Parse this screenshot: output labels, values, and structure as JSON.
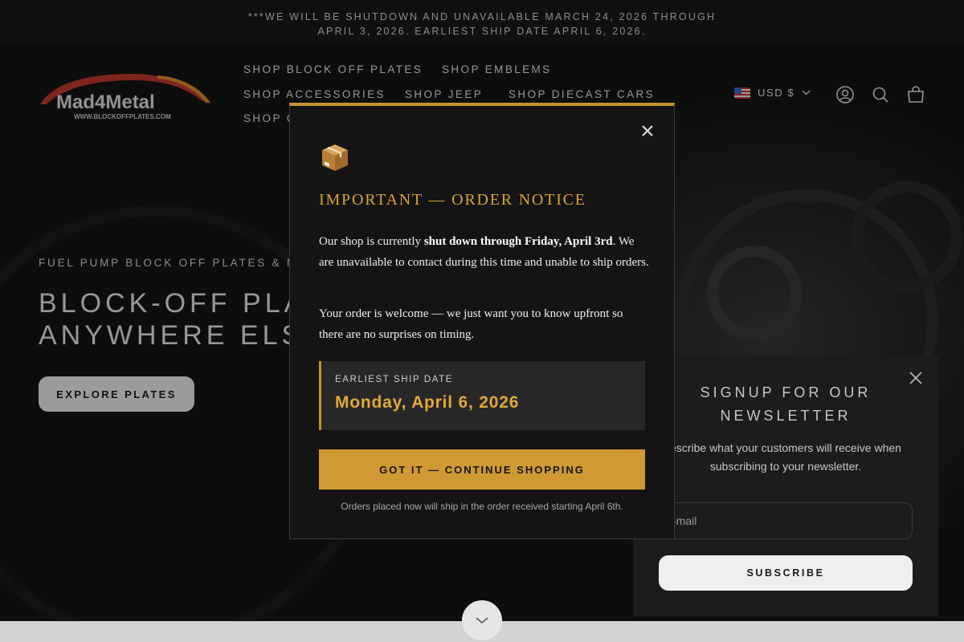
{
  "announcement": {
    "line1": "***WE WILL BE SHUTDOWN AND UNAVAILABLE MARCH 24, 2026 THROUGH",
    "line2": "APRIL 3, 2026. EARLIEST SHIP DATE APRIL 6, 2026."
  },
  "logo": {
    "text": "Mad4Metal",
    "url_text": "WWW.BLOCKOFFPLATES.COM"
  },
  "nav": {
    "items": [
      {
        "label": "SHOP BLOCK OFF PLATES"
      },
      {
        "label": "SHOP EMBLEMS"
      },
      {
        "label": "SHOP ACCESSORIES"
      },
      {
        "label": "SHOP JEEP"
      },
      {
        "label": "SHOP DIECAST CARS"
      },
      {
        "label": "SHOP C"
      }
    ]
  },
  "header": {
    "currency": "USD $",
    "icons": [
      "account-icon",
      "search-icon",
      "cart-icon"
    ]
  },
  "hero": {
    "kicker": "FUEL PUMP BLOCK OFF PLATES & MUSC",
    "title_line1": "BLOCK-OFF PLA",
    "title_line2": "ANYWHERE ELS",
    "button": "EXPLORE PLATES"
  },
  "modal": {
    "icon": "package-icon",
    "title": "IMPORTANT — ORDER NOTICE",
    "p1_pre": "Our shop is currently ",
    "p1_bold": "shut down through Friday, April 3rd",
    "p1_post": ". We are unavailable to contact during this time and unable to ship orders.",
    "p2": "Your order is welcome — we just want you to know upfront so there are no surprises on timing.",
    "ship_label": "EARLIEST SHIP DATE",
    "ship_date": "Monday, April 6, 2026",
    "cta": "GOT IT — CONTINUE SHOPPING",
    "footnote": "Orders placed now will ship in the order received starting April 6th.",
    "accent": "#c6922e"
  },
  "newsletter": {
    "title_line1": "SIGNUP FOR OUR",
    "title_line2": "NEWSLETTER",
    "desc_line1": "escribe what your customers will receive when",
    "desc_line2": "subscribing to your newsletter.",
    "email_placeholder": "-mail",
    "button": "SUBSCRIBE"
  }
}
